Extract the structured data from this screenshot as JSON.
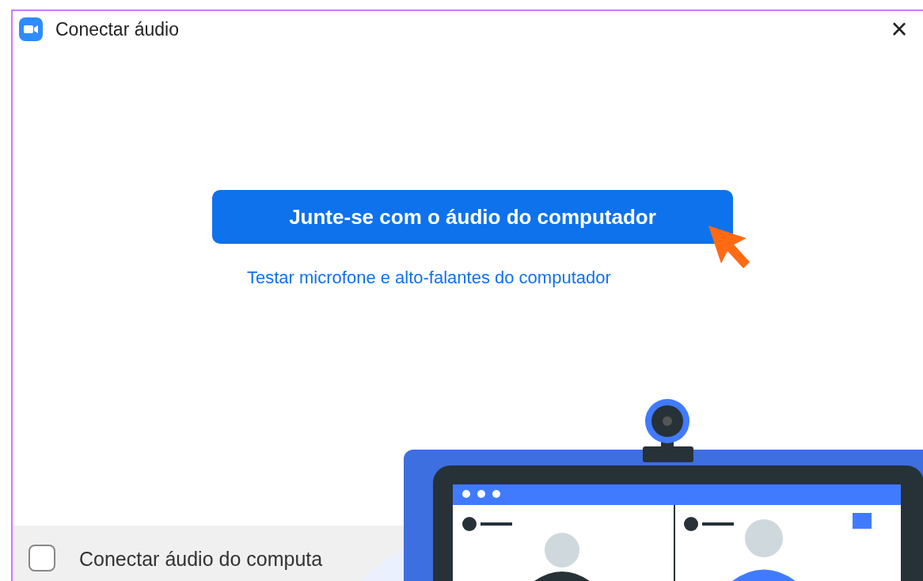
{
  "window": {
    "title": "Conectar áudio",
    "close": "×"
  },
  "join_button": {
    "label": "Junte-se com o áudio do computador"
  },
  "test_link": {
    "label": "Testar microfone e alto-falantes do computador"
  },
  "footer": {
    "checkbox": {
      "label": "Conectar áudio do computa",
      "checked": false
    }
  }
}
